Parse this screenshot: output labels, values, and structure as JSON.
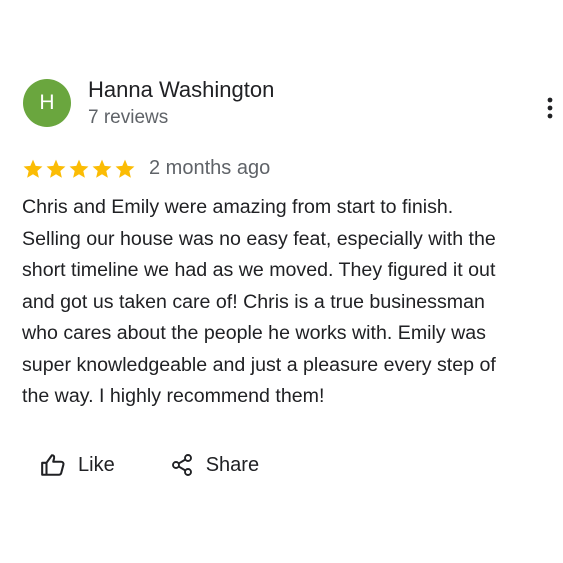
{
  "reviewer": {
    "initial": "H",
    "name": "Hanna Washington",
    "review_count": "7 reviews",
    "avatar_color": "#6aa63e"
  },
  "menu": {
    "icon": "more-vert-icon"
  },
  "rating": {
    "stars": 5,
    "max_stars": 5,
    "star_color": "#fbbc04",
    "date": "2 months ago"
  },
  "review": {
    "lines": [
      "Chris and Emily were amazing from start to finish.",
      "Selling our house was no easy feat, especially with the",
      "short timeline we had as we moved. They figured it out",
      "and got us taken care of! Chris is a true businessman",
      "who cares about the people he works with. Emily was",
      "super knowledgeable and just a pleasure every step of",
      "the way. I highly recommend them!"
    ]
  },
  "actions": {
    "like_label": "Like",
    "like_icon": "thumb-up-icon",
    "share_label": "Share",
    "share_icon": "share-icon"
  }
}
